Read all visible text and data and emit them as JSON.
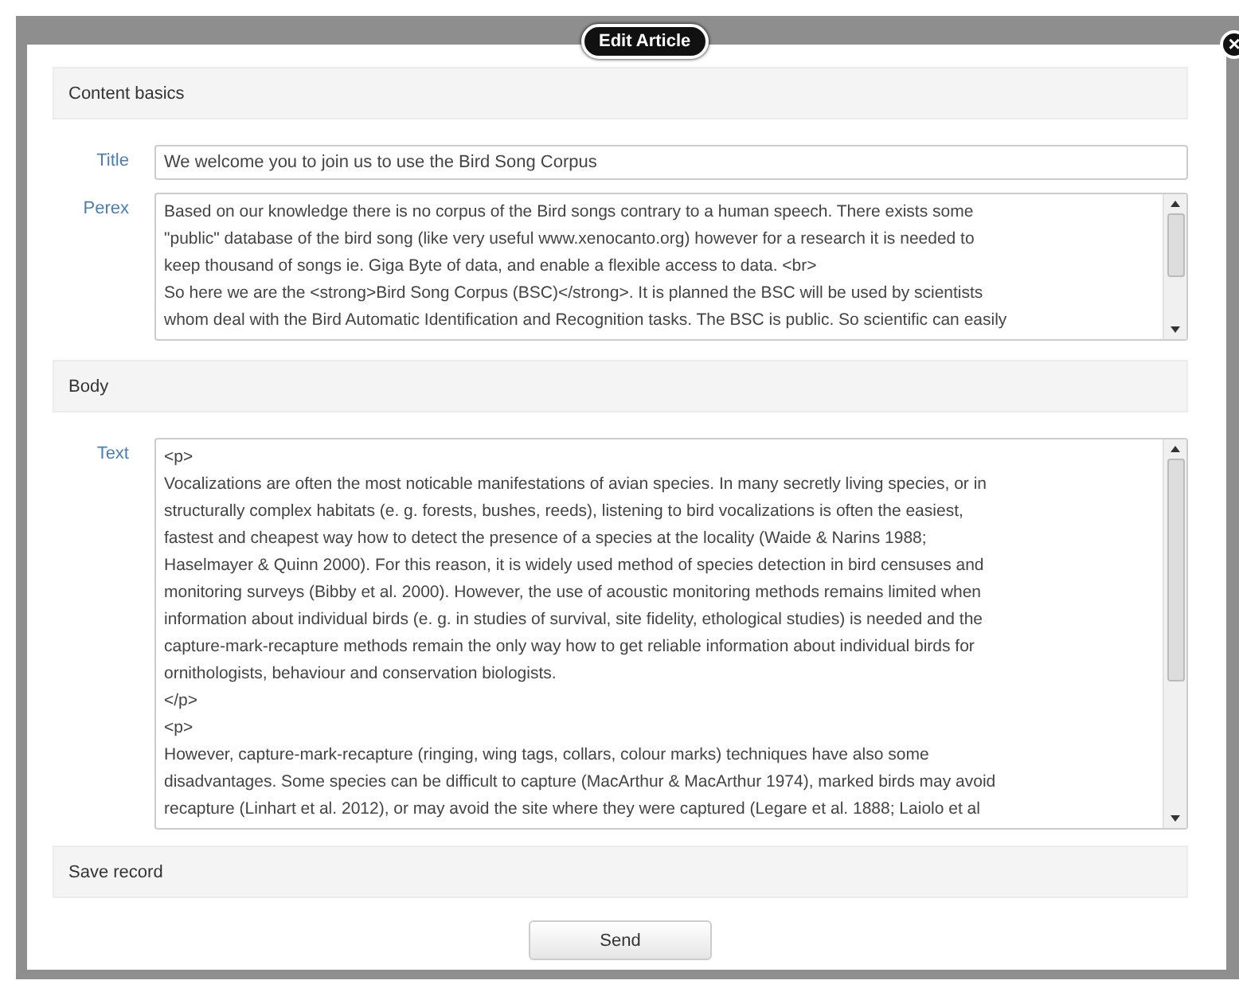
{
  "dialog": {
    "title": "Edit Article",
    "close": "×"
  },
  "sections": [
    {
      "heading": "Content basics"
    },
    {
      "heading": "Body"
    },
    {
      "heading": "Save record"
    }
  ],
  "title_field": {
    "label": "Title",
    "value": "We welcome you to join us to use the Bird Song Corpus"
  },
  "perex_field": {
    "label": "Perex",
    "lines": [
      "Based on our knowledge there is no corpus of the Bird songs contrary to a human speech. There exists some",
      "\"public\" database of the bird song (like very useful www.xenocanto.org) however for a research it is needed to",
      "keep thousand of songs ie. Giga Byte of data, and enable a flexible access to data. <br>",
      "So here we are the <strong>Bird Song Corpus (BSC)</strong>. It is planned the BSC will be used by scientists",
      "whom deal with the Bird Automatic Identification and Recognition tasks. The BSC is public. So scientific can easily"
    ]
  },
  "text_field": {
    "label": "Text",
    "lines": [
      "<p>",
      "Vocalizations are often the most noticable manifestations of avian species. In many secretly living species, or in",
      "structurally complex habitats (e. g. forests, bushes, reeds), listening to bird vocalizations is often the easiest,",
      "fastest and cheapest way how to detect the presence of a species at the locality (Waide & Narins 1988;",
      "Haselmayer & Quinn 2000). For this reason, it is widely used method of species detection in bird censuses and",
      "monitoring surveys (Bibby et al. 2000). However, the use of acoustic monitoring methods remains limited when",
      "information about individual birds (e. g. in studies of survival, site fidelity, ethological studies) is needed and the",
      "capture-mark-recapture methods remain the only way how to get reliable information about individual birds for",
      "ornithologists, behaviour and conservation biologists.",
      "</p>",
      "<p>",
      "However, capture-mark-recapture (ringing, wing tags, collars, colour marks) techniques have also some",
      "disadvantages. Some species can be difficult to capture (MacArthur & MacArthur 1974), marked birds may avoid",
      "recapture (Linhart et al. 2012), or may avoid the site where they were captured (Legare et al. 1888; Laiolo et al"
    ]
  },
  "send_button": "Send"
}
